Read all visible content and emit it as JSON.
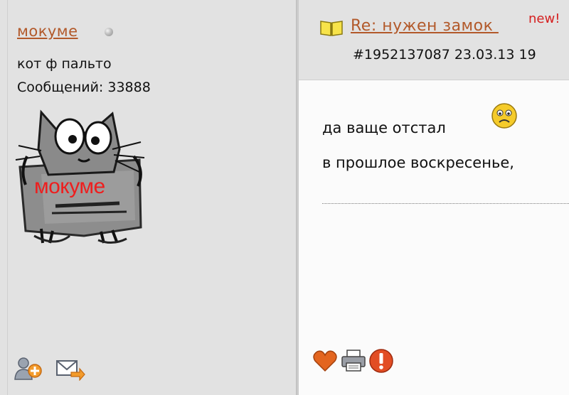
{
  "author": {
    "username": "мокуме",
    "online_status_icon": "status-dot-gray",
    "title": "кот ф пальто",
    "post_count": "Сообщений: 33888",
    "avatar_caption": "мокуме",
    "actions": [
      {
        "icon": "add-friend-icon"
      },
      {
        "icon": "send-message-icon"
      }
    ]
  },
  "post": {
    "title_icon": "open-book-icon",
    "title": "Re: нужен замок ",
    "new_badge": "new!",
    "meta": "#1952137087 23.03.13 19",
    "lines": [
      "да ваще отстал",
      "в прошлое воскресенье,"
    ],
    "smiley_icon": "sad-smiley-icon",
    "actions": [
      {
        "icon": "heart-icon"
      },
      {
        "icon": "printer-icon"
      },
      {
        "icon": "report-icon"
      }
    ]
  },
  "colors": {
    "link": "#b2592a",
    "new_badge": "#d52020",
    "panel_bg": "#e2e2e2",
    "avatar_caption": "#ee1e1e"
  }
}
